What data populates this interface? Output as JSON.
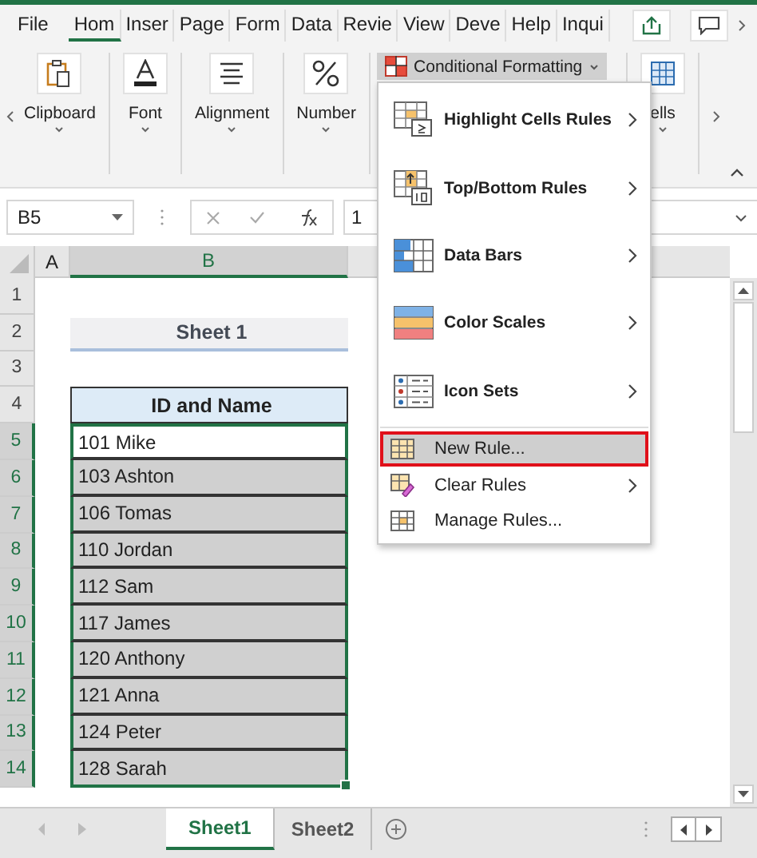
{
  "ribbon_tabs": [
    {
      "label": "File",
      "selected": false
    },
    {
      "label": "Hom",
      "selected": true
    },
    {
      "label": "Inser",
      "selected": false
    },
    {
      "label": "Page",
      "selected": false
    },
    {
      "label": "Form",
      "selected": false
    },
    {
      "label": "Data",
      "selected": false
    },
    {
      "label": "Revie",
      "selected": false
    },
    {
      "label": "View",
      "selected": false
    },
    {
      "label": "Deve",
      "selected": false
    },
    {
      "label": "Help",
      "selected": false
    },
    {
      "label": "Inqui",
      "selected": false
    }
  ],
  "ribbon_groups": [
    {
      "label": "Clipboard"
    },
    {
      "label": "Font"
    },
    {
      "label": "Alignment"
    },
    {
      "label": "Number"
    }
  ],
  "conditional_formatting": {
    "label": "Conditional Formatting",
    "menu": [
      {
        "label": "Highlight Cells Rules",
        "kind": "large",
        "submenu": true,
        "selected": false
      },
      {
        "label": "Top/Bottom Rules",
        "kind": "large",
        "submenu": true,
        "selected": false
      },
      {
        "label": "Data Bars",
        "kind": "large",
        "submenu": true,
        "selected": false
      },
      {
        "label": "Color Scales",
        "kind": "large",
        "submenu": true,
        "selected": false
      },
      {
        "label": "Icon Sets",
        "kind": "large",
        "submenu": true,
        "selected": false
      },
      {
        "label": "New Rule...",
        "kind": "small",
        "submenu": false,
        "selected": true
      },
      {
        "label": "Clear Rules",
        "kind": "small",
        "submenu": true,
        "selected": false
      },
      {
        "label": "Manage Rules...",
        "kind": "small",
        "submenu": false,
        "selected": false
      }
    ]
  },
  "cells_group": {
    "label": "ells"
  },
  "name_box": {
    "value": "B5"
  },
  "formula_bar": {
    "value": "1"
  },
  "column_headers": [
    {
      "label": "A",
      "selected": false
    },
    {
      "label": "B",
      "selected": true
    }
  ],
  "rows": [
    {
      "number": "1",
      "kind": "blank",
      "selected": false
    },
    {
      "number": "2",
      "kind": "title",
      "value": "Sheet 1",
      "selected": false
    },
    {
      "number": "3",
      "kind": "blank",
      "selected": false
    },
    {
      "number": "4",
      "kind": "header",
      "value": "ID and Name",
      "selected": false
    },
    {
      "number": "5",
      "kind": "data",
      "value": "101 Mike",
      "selected": true
    },
    {
      "number": "6",
      "kind": "data",
      "value": "103 Ashton",
      "selected": true
    },
    {
      "number": "7",
      "kind": "data",
      "value": "106 Tomas",
      "selected": true
    },
    {
      "number": "8",
      "kind": "data",
      "value": "110 Jordan",
      "selected": true
    },
    {
      "number": "9",
      "kind": "data",
      "value": "112 Sam",
      "selected": true
    },
    {
      "number": "10",
      "kind": "data",
      "value": "117 James",
      "selected": true
    },
    {
      "number": "11",
      "kind": "data",
      "value": "120 Anthony",
      "selected": true
    },
    {
      "number": "12",
      "kind": "data",
      "value": "121 Anna",
      "selected": true
    },
    {
      "number": "13",
      "kind": "data",
      "value": "124 Peter",
      "selected": true
    },
    {
      "number": "14",
      "kind": "data",
      "value": "128 Sarah",
      "selected": true
    }
  ],
  "sheet_tabs": [
    {
      "label": "Sheet1",
      "selected": true
    },
    {
      "label": "Sheet2",
      "selected": false
    }
  ]
}
